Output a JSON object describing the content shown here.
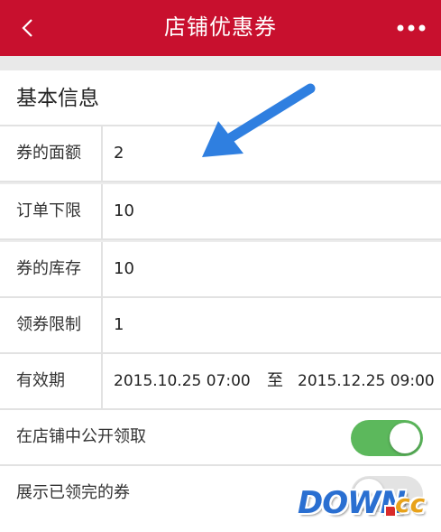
{
  "header": {
    "title": "店铺优惠券",
    "back_icon": "chevron-left-icon",
    "more_icon": "more-dots-icon"
  },
  "section": {
    "title": "基本信息"
  },
  "fields": [
    {
      "label": "券的面额",
      "value": "2"
    },
    {
      "label": "订单下限",
      "value": "10"
    },
    {
      "label": "券的库存",
      "value": "10"
    },
    {
      "label": "领券限制",
      "value": "1"
    }
  ],
  "validity": {
    "label": "有效期",
    "start": "2015.10.25 07:00",
    "separator": "至",
    "end": "2015.12.25 09:00"
  },
  "toggles": {
    "public": {
      "label": "在店铺中公开领取",
      "on": true
    },
    "show_claimed": {
      "label": "展示已领完的券",
      "on": false
    }
  },
  "colors": {
    "header": "#c8102e",
    "toggle_on": "#5cb85c",
    "arrow": "#2f7fe0"
  },
  "watermark": {
    "text": "DOWN.cc"
  }
}
